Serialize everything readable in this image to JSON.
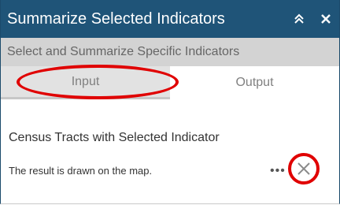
{
  "titlebar": {
    "title": "Summarize Selected Indicators",
    "collapse_icon": "double-chevron-up-icon",
    "close_icon": "close-icon"
  },
  "subtitle": "Select and Summarize Specific Indicators",
  "tabs": [
    {
      "label": "Input",
      "active": true
    },
    {
      "label": "Output",
      "active": false
    }
  ],
  "content": {
    "section_title": "Census Tracts with Selected Indicator",
    "result_text": "The result is drawn on the map.",
    "more_icon": "ellipsis-icon",
    "remove_icon": "x-icon"
  },
  "colors": {
    "header": "#1f5478",
    "subtitle_bg": "#d3d3d3",
    "annotation": "#e00000"
  }
}
